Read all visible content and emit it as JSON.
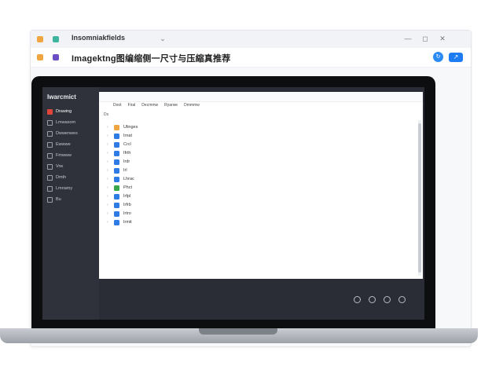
{
  "browser": {
    "tab_title": "Insomniakfields",
    "page_title": "Imagektng图编缩侧一尺寸与压縮真推荐",
    "window_controls": [
      "—",
      "◻",
      "✕"
    ]
  },
  "app": {
    "brand": "Iwarcmict",
    "sidebar": [
      {
        "label": "Drawing",
        "icon": "image-icon",
        "active": true
      },
      {
        "label": "Lmwaxom",
        "icon": "folder-icon",
        "active": false
      },
      {
        "label": "Dwwenwes",
        "icon": "grid-icon",
        "active": false
      },
      {
        "label": "Ewwwe",
        "icon": "doc-icon",
        "active": false
      },
      {
        "label": "Fmwww",
        "icon": "doc-icon",
        "active": false
      },
      {
        "label": "Vrw",
        "icon": "gear-icon",
        "active": false
      },
      {
        "label": "Dmth",
        "icon": "clock-icon",
        "active": false
      },
      {
        "label": "Lmnamy",
        "icon": "doc-icon",
        "active": false
      },
      {
        "label": "Bu",
        "icon": "grid-icon",
        "active": false
      }
    ],
    "explorer": {
      "menu": [
        "Doot",
        "Firal",
        "Decmmw",
        "Ryarwe",
        "Dmmmw"
      ],
      "subbar": "Ds",
      "files": [
        {
          "name": "Ulinges",
          "color": "#f0a640"
        },
        {
          "name": "Irnat",
          "color": "#2f7be6"
        },
        {
          "name": "Crcl",
          "color": "#2f7be6"
        },
        {
          "name": "Ifrth",
          "color": "#2f7be6"
        },
        {
          "name": "Irdr",
          "color": "#2f7be6"
        },
        {
          "name": "Irl",
          "color": "#2f7be6"
        },
        {
          "name": "Lhrac",
          "color": "#2f7be6"
        },
        {
          "name": "Phct",
          "color": "#38a84a"
        },
        {
          "name": "Irfpl",
          "color": "#2f7be6"
        },
        {
          "name": "Irfrb",
          "color": "#2f7be6"
        },
        {
          "name": "Irtro",
          "color": "#2f7be6"
        },
        {
          "name": "Irmit",
          "color": "#2f7be6"
        }
      ]
    }
  }
}
